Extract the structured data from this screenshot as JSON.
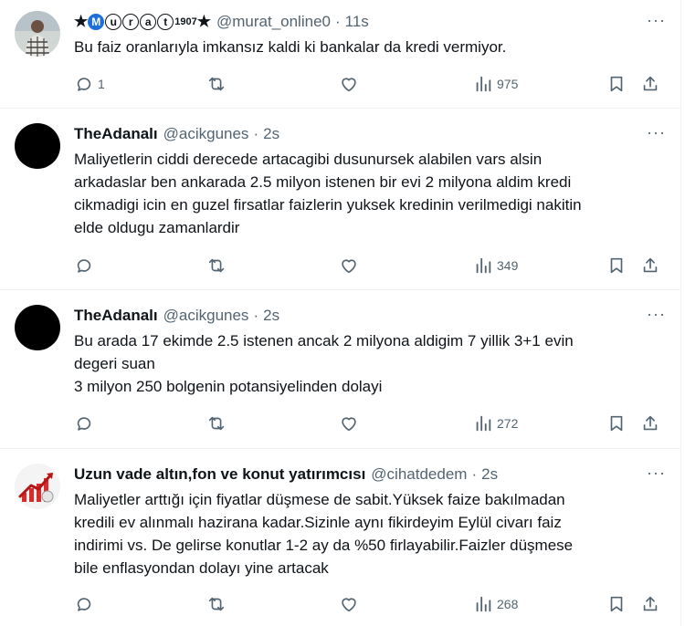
{
  "tweets": [
    {
      "name_prefix": "★",
      "name_letters": [
        "M",
        "u",
        "r",
        "a",
        "t"
      ],
      "name_sup": "1907",
      "name_suffix": "★",
      "handle": "@murat_online0",
      "time": "11s",
      "text": "Bu faiz oranlarıyla imkansız kaldi ki bankalar da kredi vermiyor.",
      "replies": "1",
      "retweets": "",
      "likes": "",
      "views": "975"
    },
    {
      "name": "TheAdanalı",
      "handle": "@acikgunes",
      "time": "2s",
      "text": "Maliyetlerin ciddi derecede artacagibi dusunursek alabilen vars alsin\narkadaslar ben ankarada 2.5 milyon istenen bir evi 2 milyona aldim kredi\ncikmadigi icin en guzel firsatlar faizlerin yuksek kredinin verilmedigi nakitin\nelde oldugu zamanlardir",
      "replies": "",
      "retweets": "",
      "likes": "",
      "views": "349"
    },
    {
      "name": "TheAdanalı",
      "handle": "@acikgunes",
      "time": "2s",
      "text": "Bu arada 17 ekimde 2.5 istenen ancak 2 milyona aldigim 7 yillik 3+1 evin\ndegeri suan\n3 milyon 250 bolgenin potansiyelinden dolayi",
      "replies": "",
      "retweets": "",
      "likes": "",
      "views": "272"
    },
    {
      "name": "Uzun vade altın,fon ve konut yatırımcısı",
      "handle": "@cihatdedem",
      "time": "2s",
      "text": "Maliyetler arttığı için fiyatlar düşmese de sabit.Yüksek faize bakılmadan\nkredili ev alınmalı hazirana kadar.Sizinle aynı fikirdeyim Eylül civarı faiz\nindirimi vs. De gelirse konutlar 1-2 ay da %50 firlayabilir.Faizler düşmese\nbile enflasyondan dolayı yine artacak",
      "replies": "",
      "retweets": "",
      "likes": "",
      "views": "268"
    }
  ],
  "separator": "·",
  "more_glyph": "···",
  "colors": {
    "text": "#0f1419",
    "secondary": "#536471",
    "border": "#eff3f4",
    "badge": "#1d6fd9"
  }
}
